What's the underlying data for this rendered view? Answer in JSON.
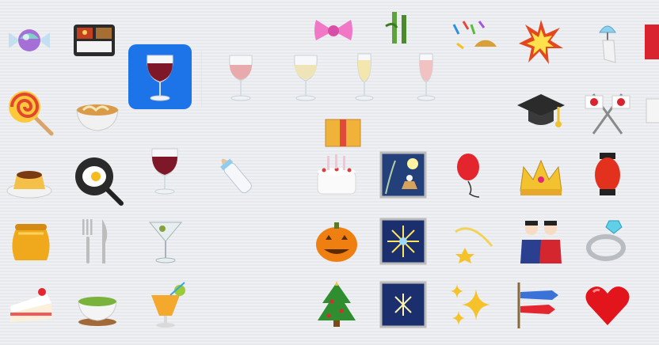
{
  "palette": {
    "selected_bg": "#1d73e8",
    "wine_red": "#7e1828",
    "rose": "#e8aaaa",
    "white_wine": "#efe3b8",
    "champagne": "#f3e7ae",
    "pink_champagne": "#f2c2c2"
  },
  "emoji_grid": [
    {
      "icon": "candy-icon",
      "glyph": "🍬"
    },
    {
      "icon": "bento-box-icon",
      "glyph": "🍱"
    },
    {
      "icon": "ribbon-icon",
      "glyph": "🎀"
    },
    {
      "icon": "bamboo-icon",
      "glyph": "🎍"
    },
    {
      "icon": "confetti-ball-icon",
      "glyph": "🎊"
    },
    {
      "icon": "collision-icon",
      "glyph": "💥"
    },
    {
      "icon": "wind-chime-icon",
      "glyph": "🎐"
    },
    {
      "icon": "lollipop-icon",
      "glyph": "🍭"
    },
    {
      "icon": "noodle-bowl-icon",
      "glyph": "🍜"
    },
    {
      "icon": "wrapped-gift-icon",
      "glyph": "🎁"
    },
    {
      "icon": "graduation-cap-icon",
      "glyph": "🎓"
    },
    {
      "icon": "crossed-flags-icon",
      "glyph": "🎌"
    },
    {
      "icon": "custard-icon",
      "glyph": "🍮"
    },
    {
      "icon": "fried-egg-icon",
      "glyph": "🍳"
    },
    {
      "icon": "baby-bottle-icon",
      "glyph": "🍼"
    },
    {
      "icon": "birthday-cake-icon",
      "glyph": "🎂"
    },
    {
      "icon": "moon-viewing-icon",
      "glyph": "🎑"
    },
    {
      "icon": "balloon-icon",
      "glyph": "🎈"
    },
    {
      "icon": "crown-icon",
      "glyph": "👑"
    },
    {
      "icon": "red-lantern-icon",
      "glyph": "🏮"
    },
    {
      "icon": "honey-pot-icon",
      "glyph": "🍯"
    },
    {
      "icon": "fork-and-knife-icon",
      "glyph": "🍴"
    },
    {
      "icon": "cocktail-glass-icon",
      "glyph": "🍸"
    },
    {
      "icon": "jack-o-lantern-icon",
      "glyph": "🎃"
    },
    {
      "icon": "fireworks-icon",
      "glyph": "🎆"
    },
    {
      "icon": "dizzy-icon",
      "glyph": "💫"
    },
    {
      "icon": "dolls-icon",
      "glyph": "🎎"
    },
    {
      "icon": "ring-icon",
      "glyph": "💍"
    },
    {
      "icon": "shortcake-icon",
      "glyph": "🍰"
    },
    {
      "icon": "green-tea-icon",
      "glyph": "🍵"
    },
    {
      "icon": "tropical-drink-icon",
      "glyph": "🍹"
    },
    {
      "icon": "christmas-tree-icon",
      "glyph": "🎄"
    },
    {
      "icon": "sparkler-icon",
      "glyph": "🎇"
    },
    {
      "icon": "sparkles-icon",
      "glyph": "✨"
    },
    {
      "icon": "carp-streamer-icon",
      "glyph": "🎏"
    },
    {
      "icon": "red-heart-icon",
      "glyph": "❤"
    }
  ],
  "variant_popup": {
    "selected": {
      "icon": "red-wine-glass-icon",
      "glyph": "🍷"
    },
    "variants": [
      {
        "icon": "rose-wine-glass-icon"
      },
      {
        "icon": "white-wine-glass-icon"
      },
      {
        "icon": "champagne-flute-icon"
      },
      {
        "icon": "pink-champagne-flute-icon"
      }
    ],
    "base": {
      "icon": "red-wine-glass-icon",
      "glyph": "🍷"
    }
  }
}
